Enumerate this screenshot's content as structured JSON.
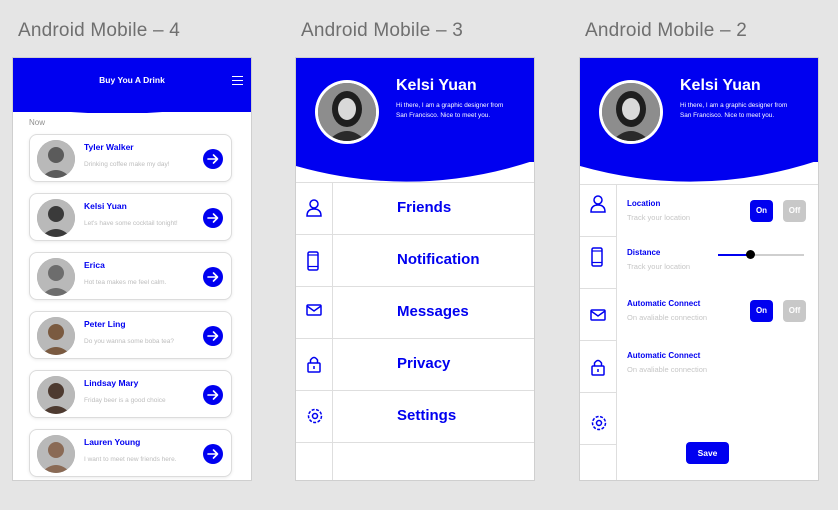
{
  "frames": [
    {
      "title": "Android Mobile – 4"
    },
    {
      "title": "Android Mobile – 3"
    },
    {
      "title": "Android Mobile – 2"
    }
  ],
  "colors": {
    "brand": "#0000f0",
    "background": "#e5e5e5",
    "muted": "#bdbdbd",
    "off": "#c8c8c8"
  },
  "friends_screen": {
    "title": "Buy You A Drink",
    "menu_icon": "hamburger-icon",
    "section_label": "Now",
    "contacts": [
      {
        "name": "Tyler Walker",
        "message": "Drinking coffee make my day!"
      },
      {
        "name": "Kelsi Yuan",
        "message": "Let's have some cocktail tonight!"
      },
      {
        "name": "Erica",
        "message": "Hot tea makes me feel calm."
      },
      {
        "name": "Peter Ling",
        "message": "Do you wanna some boba tea?"
      },
      {
        "name": "Lindsay Mary",
        "message": "Friday beer is a good choice"
      },
      {
        "name": "Lauren Young",
        "message": "I want to meet new friends here."
      }
    ]
  },
  "profile": {
    "name": "Kelsi Yuan",
    "bio": "Hi there, I am a graphic designer from San Francisco. Nice to meet you."
  },
  "menu_screen": {
    "items": [
      {
        "label": "Friends",
        "icon": "person-icon"
      },
      {
        "label": "Notification",
        "icon": "phone-icon"
      },
      {
        "label": "Messages",
        "icon": "mail-icon"
      },
      {
        "label": "Privacy",
        "icon": "lock-icon"
      },
      {
        "label": "Settings",
        "icon": "gear-icon"
      }
    ]
  },
  "settings_screen": {
    "location": {
      "title": "Location",
      "subtitle": "Track your location",
      "on_label": "On",
      "off_label": "Off"
    },
    "distance": {
      "title": "Distance",
      "subtitle": "Track your location",
      "level": 0.38
    },
    "auto_connect_1": {
      "title": "Automatic Connect",
      "subtitle": "On avaliable connection",
      "on_label": "On",
      "off_label": "Off"
    },
    "auto_connect_2": {
      "title": "Automatic Connect",
      "subtitle": "On avaliable connection"
    },
    "save_label": "Save"
  }
}
